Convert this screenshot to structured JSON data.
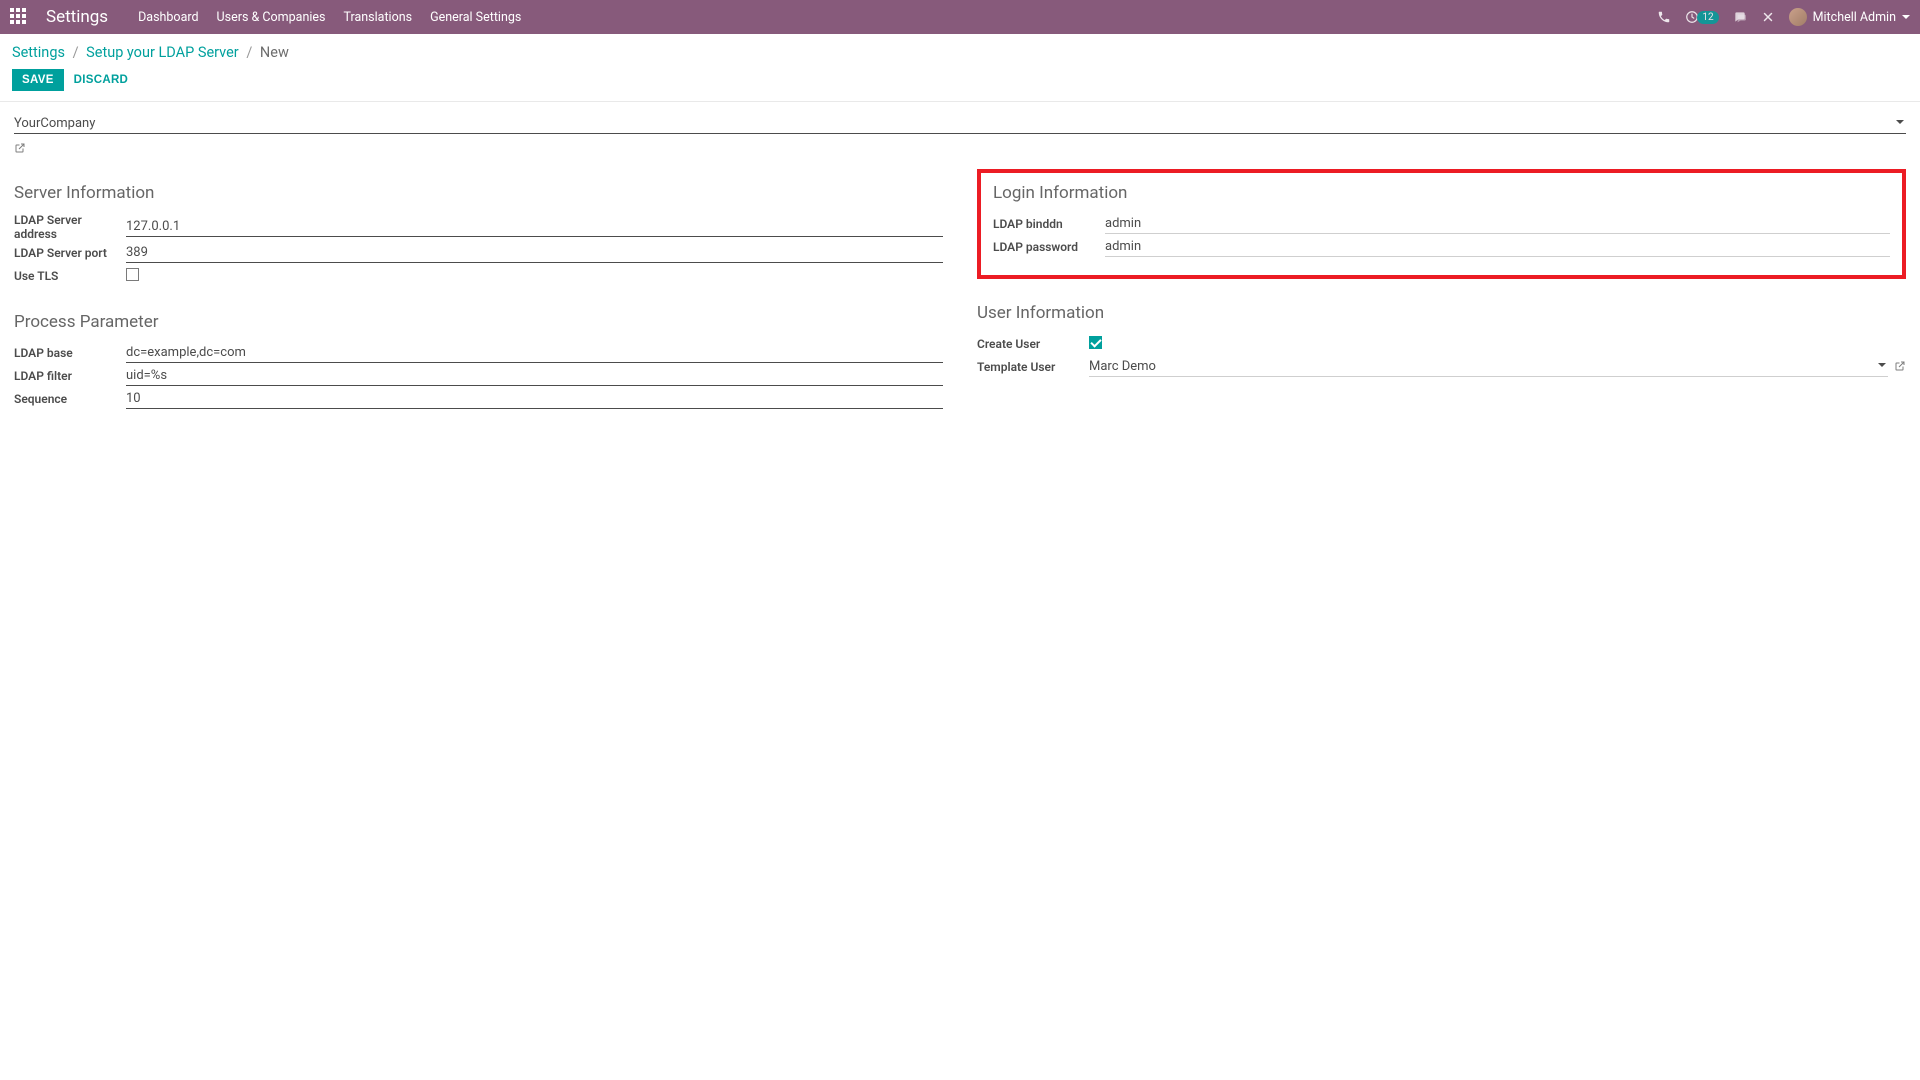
{
  "navbar": {
    "brand": "Settings",
    "links": [
      "Dashboard",
      "Users & Companies",
      "Translations",
      "General Settings"
    ],
    "badge_count": "12",
    "user_name": "Mitchell Admin"
  },
  "breadcrumb": {
    "root": "Settings",
    "mid": "Setup your LDAP Server",
    "leaf": "New"
  },
  "buttons": {
    "save": "Save",
    "discard": "Discard"
  },
  "company": "YourCompany",
  "sections": {
    "server": "Server Information",
    "login": "Login Information",
    "process": "Process Parameter",
    "user": "User Information"
  },
  "labels": {
    "server_addr": "LDAP Server address",
    "server_port": "LDAP Server port",
    "use_tls": "Use TLS",
    "binddn": "LDAP binddn",
    "password": "LDAP password",
    "base": "LDAP base",
    "filter": "LDAP filter",
    "sequence": "Sequence",
    "create_user": "Create User",
    "template_user": "Template User"
  },
  "values": {
    "server_addr": "127.0.0.1",
    "server_port": "389",
    "use_tls": false,
    "binddn": "admin",
    "password": "admin",
    "base": "dc=example,dc=com",
    "filter": "uid=%s",
    "sequence": "10",
    "create_user": true,
    "template_user": "Marc Demo"
  }
}
